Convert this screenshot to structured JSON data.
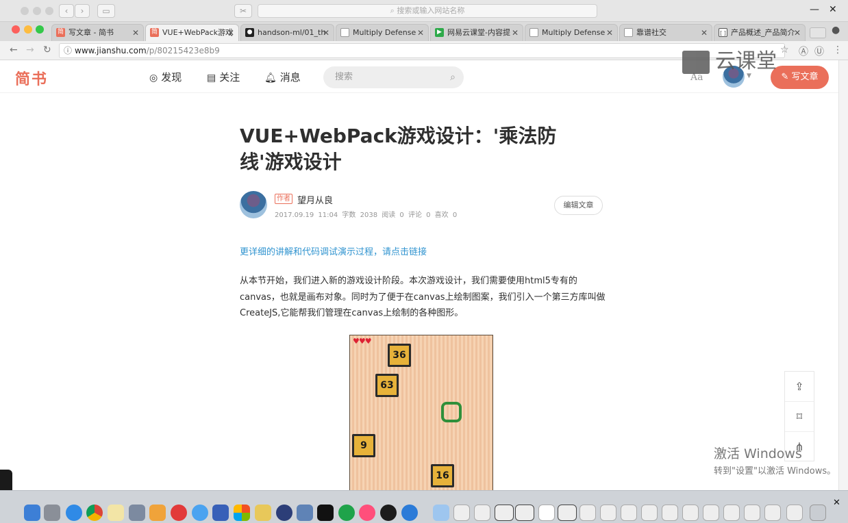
{
  "outer_window": {
    "search_placeholder": "搜索或输入网站名称"
  },
  "tabs": [
    {
      "label": "写文章 - 简书",
      "fav_color": "#ea6f5a",
      "fav_glyph": "简"
    },
    {
      "label": "VUE+WebPack游戏",
      "fav_color": "#ea6f5a",
      "fav_glyph": "简"
    },
    {
      "label": "handson-ml/01_th",
      "fav_color": "#222222",
      "fav_glyph": "●"
    },
    {
      "label": "Multiply Defense",
      "fav_color": "#bbbbbb",
      "fav_glyph": "▯"
    },
    {
      "label": "网易云课堂-内容提",
      "fav_color": "#2eaa4a",
      "fav_glyph": "▶"
    },
    {
      "label": "Multiply Defense",
      "fav_color": "#bbbbbb",
      "fav_glyph": "▯"
    },
    {
      "label": "靠谱社交",
      "fav_color": "#bbbbbb",
      "fav_glyph": "▯"
    },
    {
      "label": "产品概述_产品简介",
      "fav_color": "#555555",
      "fav_glyph": "[]"
    }
  ],
  "omnibox": {
    "host": "www.jianshu.com",
    "path": "/p/80215423e8b9"
  },
  "header": {
    "logo": "简书",
    "nav": [
      "发现",
      "关注",
      "消息"
    ],
    "search_placeholder": "搜索",
    "font_toggle": "Aa",
    "write_button": "写文章"
  },
  "watermark": "云课堂",
  "article": {
    "title": "VUE+WebPack游戏设计：'乘法防线'游戏设计",
    "author_tag": "作者",
    "author_name": "望月从良",
    "meta": "2017.09.19 11:04  字数 2038  阅读 0  评论 0  喜欢 0",
    "edit_button": "编辑文章",
    "link_text": "更详细的讲解和代码调试演示过程，请点击链接",
    "paragraph": "从本节开始，我们进入新的游戏设计阶段。本次游戏设计，我们需要使用html5专有的canvas，也就是画布对象。同时为了便于在canvas上绘制图案，我们引入一个第三方库叫做CreateJS,它能帮我们管理在canvas上绘制的各种图形。"
  },
  "game": {
    "hearts": "♥♥♥",
    "blocks": [
      "36",
      "63",
      "9",
      "16"
    ]
  },
  "activate": {
    "line1": "激活 Windows",
    "line2": "转到\"设置\"以激活 Windows。"
  },
  "colors": {
    "brand": "#ea6f5a",
    "link": "#3194d0"
  }
}
